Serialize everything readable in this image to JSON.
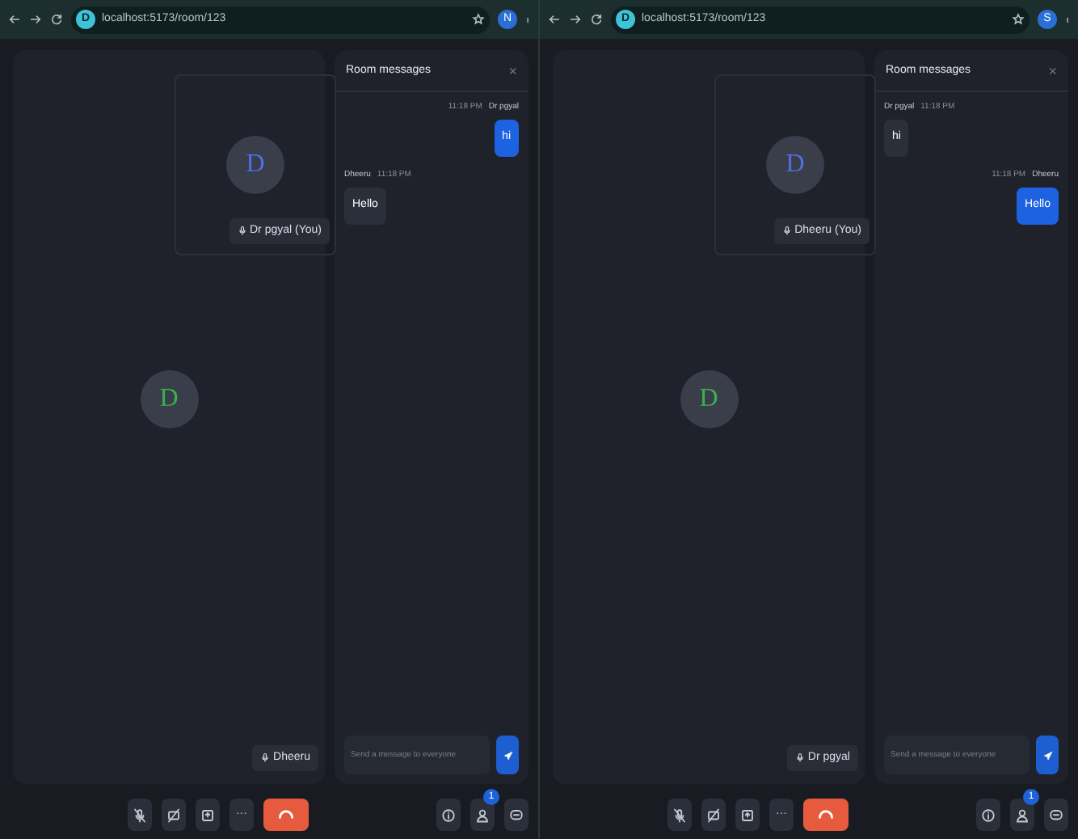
{
  "windows": [
    {
      "browser": {
        "url": "localhost:5173/room/123",
        "site_letter": "D",
        "profile_letter": "N"
      },
      "self_tile": {
        "letter": "D",
        "color": "#4f6fe0",
        "name": "Dr pgyal (You)"
      },
      "main_tile": {
        "letter": "D",
        "color": "#3cb04a",
        "name": "Dheeru"
      },
      "chat": {
        "title": "Room messages",
        "close": "×",
        "placeholder": "Send a message to everyone",
        "messages": [
          {
            "sender": "Dr pgyal",
            "time": "11:18 PM",
            "text": "hi",
            "own": true
          },
          {
            "sender": "Dheeru",
            "time": "11:18 PM",
            "text": "Hello",
            "own": false
          }
        ]
      },
      "toolbar": {
        "more": "···",
        "people_badge": "1"
      }
    },
    {
      "browser": {
        "url": "localhost:5173/room/123",
        "site_letter": "D",
        "profile_letter": "S"
      },
      "self_tile": {
        "letter": "D",
        "color": "#4f6fe0",
        "name": "Dheeru (You)"
      },
      "main_tile": {
        "letter": "D",
        "color": "#3cb04a",
        "name": "Dr pgyal"
      },
      "chat": {
        "title": "Room messages",
        "close": "×",
        "placeholder": "Send a message to everyone",
        "messages": [
          {
            "sender": "Dr pgyal",
            "time": "11:18 PM",
            "text": "hi",
            "own": false
          },
          {
            "sender": "Dheeru",
            "time": "11:18 PM",
            "text": "Hello",
            "own": true
          }
        ]
      },
      "toolbar": {
        "more": "···",
        "people_badge": "1"
      }
    }
  ]
}
